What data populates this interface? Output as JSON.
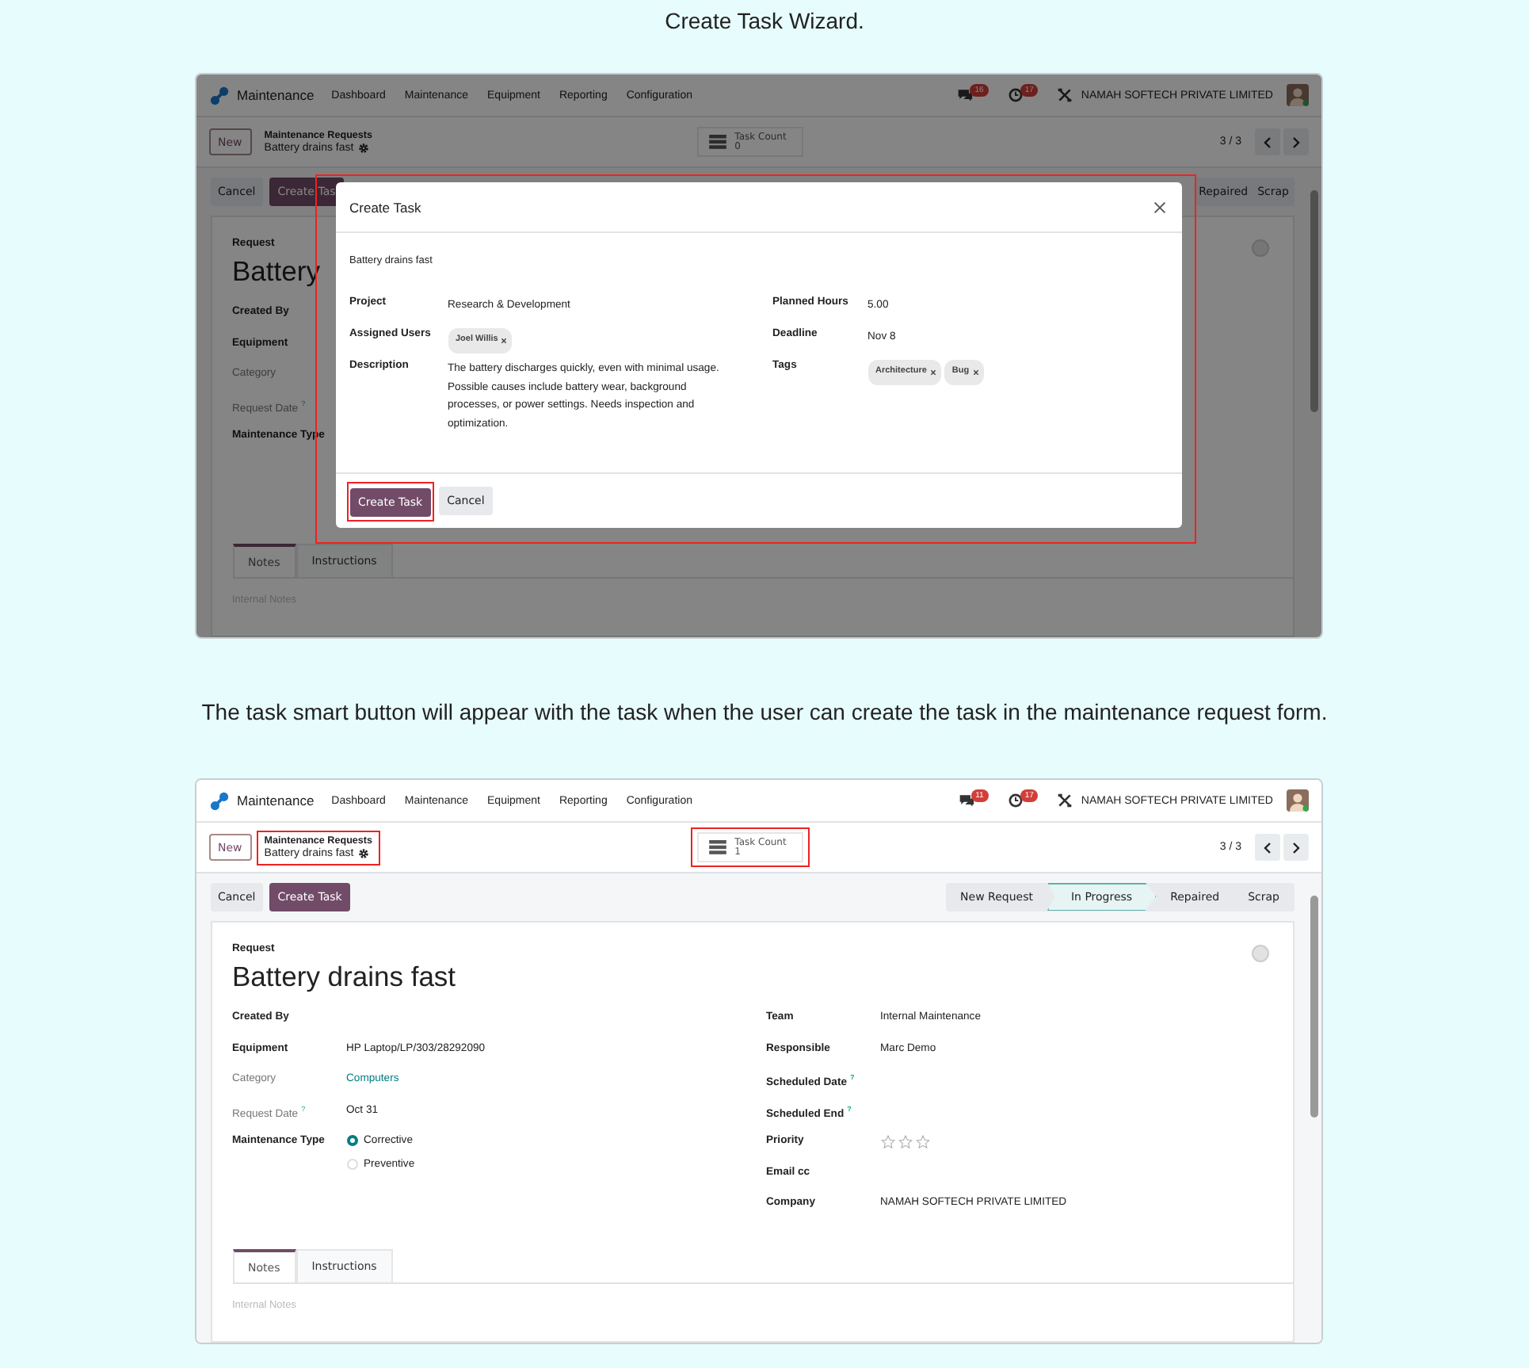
{
  "intro_caption": "Create Task Wizard.",
  "wizard_screenshot": {
    "navbar": {
      "app": "Maintenance",
      "menus": [
        "Dashboard",
        "Maintenance",
        "Equipment",
        "Reporting",
        "Configuration"
      ],
      "chat_badge": "16",
      "activity_badge": "17",
      "company": "NAMAH SOFTECH PRIVATE LIMITED"
    },
    "control_panel": {
      "new_button": "New",
      "breadcrumb_parent": "Maintenance Requests",
      "breadcrumb_current": "Battery drains fast",
      "highlighted": false,
      "task_count_label": "Task Count",
      "task_count_value": "0",
      "task_count_highlighted": false,
      "pager": "3 / 3"
    },
    "actions": [
      "Cancel",
      "Create Tas"
    ],
    "statusbar": [
      {
        "label": "Repaired",
        "selected": false
      },
      {
        "label": "Scrap",
        "selected": false
      }
    ],
    "form": {
      "request_label": "Request",
      "title": "Battery",
      "left_fields": [
        {
          "label": "Created By",
          "bold": true
        },
        {
          "label": "Equipment",
          "bold": true
        },
        {
          "label": "Category",
          "bold": false
        },
        {
          "label": "Request Date",
          "bold": false,
          "help": "?"
        },
        {
          "label": "Maintenance Type",
          "bold": true
        }
      ],
      "tabs": [
        {
          "label": "Notes",
          "selected": true
        },
        {
          "label": "Instructions",
          "selected": false
        }
      ],
      "notes_placeholder": "Internal Notes"
    },
    "dialog": {
      "title": "Create Task",
      "name": "Battery drains fast",
      "left_fields": [
        {
          "label": "Project",
          "kind": "text",
          "value": "Research & Development"
        },
        {
          "label": "Assigned Users",
          "kind": "tags",
          "tags": [
            "Joel Willis"
          ]
        },
        {
          "label": "Description",
          "kind": "text",
          "value": "The battery discharges quickly, even with minimal usage. Possible causes include battery wear, background processes, or power settings. Needs inspection and optimization."
        }
      ],
      "right_fields": [
        {
          "label": "Planned Hours",
          "kind": "text",
          "value": "5.00"
        },
        {
          "label": "Deadline",
          "kind": "text",
          "value": "Nov 8"
        },
        {
          "label": "Tags",
          "kind": "tags",
          "tags": [
            "Architecture",
            "Bug"
          ]
        }
      ],
      "primary_button": "Create Task",
      "primary_highlighted": true,
      "secondary_button": "Cancel"
    }
  },
  "note_caption": "The task smart button will appear with the task when the user can create the task in the maintenance request form.",
  "form_screenshot": {
    "navbar": {
      "app": "Maintenance",
      "menus": [
        "Dashboard",
        "Maintenance",
        "Equipment",
        "Reporting",
        "Configuration"
      ],
      "chat_badge": "11",
      "activity_badge": "17",
      "company": "NAMAH SOFTECH PRIVATE LIMITED"
    },
    "control_panel": {
      "new_button": "New",
      "breadcrumb_parent": "Maintenance Requests",
      "breadcrumb_current": "Battery drains fast",
      "highlighted": true,
      "task_count_label": "Task Count",
      "task_count_value": "1",
      "task_count_highlighted": true,
      "pager": "3 / 3"
    },
    "actions": [
      "Cancel",
      "Create Task"
    ],
    "statusbar": [
      {
        "label": "New Request",
        "selected": false
      },
      {
        "label": "In Progress",
        "selected": true
      },
      {
        "label": "Repaired",
        "selected": false
      },
      {
        "label": "Scrap",
        "selected": false
      }
    ],
    "form": {
      "request_label": "Request",
      "title": "Battery drains fast",
      "left_fields": [
        {
          "label": "Created By",
          "bold": true
        },
        {
          "label": "Equipment",
          "bold": true,
          "kind": "text",
          "value": "HP Laptop/LP/303/28292090"
        },
        {
          "label": "Category",
          "bold": false,
          "kind": "link",
          "value": "Computers"
        },
        {
          "label": "Request Date",
          "bold": false,
          "help": "?",
          "kind": "text",
          "value": "Oct 31"
        },
        {
          "label": "Maintenance Type",
          "bold": true,
          "kind": "radio",
          "options": [
            {
              "label": "Corrective",
              "selected": true
            },
            {
              "label": "Preventive",
              "selected": false
            }
          ]
        }
      ],
      "right_fields": [
        {
          "label": "Team",
          "bold": true,
          "kind": "text",
          "value": "Internal Maintenance"
        },
        {
          "label": "Responsible",
          "bold": true,
          "kind": "text",
          "value": "Marc Demo"
        },
        {
          "label": "Scheduled Date",
          "bold": true,
          "help": "?"
        },
        {
          "label": "Scheduled End",
          "bold": true,
          "help": "?"
        },
        {
          "label": "Priority",
          "bold": true,
          "kind": "stars",
          "stars": 0
        },
        {
          "label": "Email cc",
          "bold": true
        },
        {
          "label": "Company",
          "bold": true,
          "kind": "text",
          "value": "NAMAH SOFTECH PRIVATE LIMITED"
        }
      ],
      "tabs": [
        {
          "label": "Notes",
          "selected": true
        },
        {
          "label": "Instructions",
          "selected": false
        }
      ],
      "notes_placeholder": "Internal Notes"
    }
  }
}
